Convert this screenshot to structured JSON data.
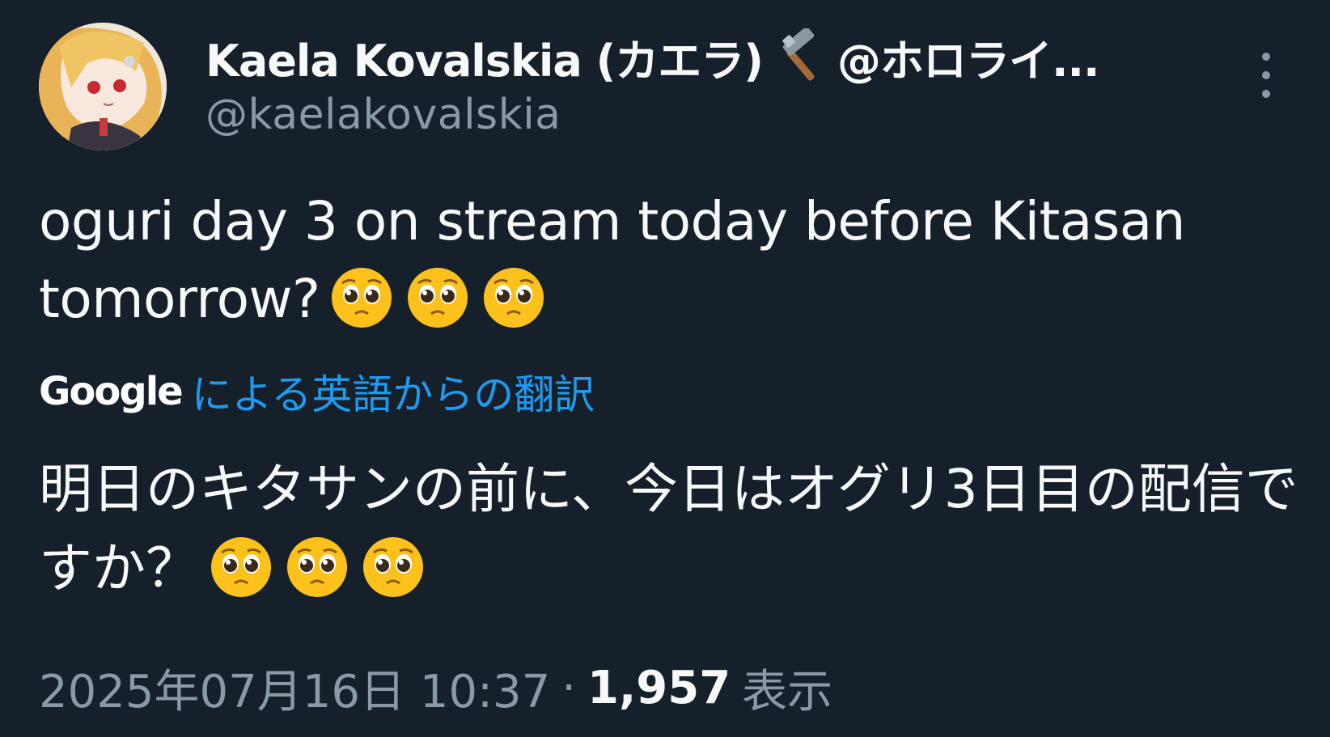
{
  "author": {
    "display_name": "Kaela Kovalskia (カエラ)",
    "handle_suffix": "@ホロライ...",
    "username": "@kaelakovalskia",
    "badge_icon": "hammer-icon"
  },
  "tweet": {
    "text": "oguri day 3 on stream today before Kitasan tomorrow?",
    "emoji_icon": "pleading-face-emoji"
  },
  "translation": {
    "provider": "Google",
    "label": "による英語からの翻訳",
    "text": "明日のキタサンの前に、今日はオグリ3日目の配信ですか？"
  },
  "meta": {
    "timestamp": "2025年07月16日 10:37",
    "separator": "·",
    "views": "1,957",
    "views_label": "表示"
  },
  "colors": {
    "background": "#15202b",
    "primary_text": "#f7f9f9",
    "secondary_text": "#8b98a5",
    "link": "#1d9bf0",
    "emoji": "#fcc21b"
  }
}
